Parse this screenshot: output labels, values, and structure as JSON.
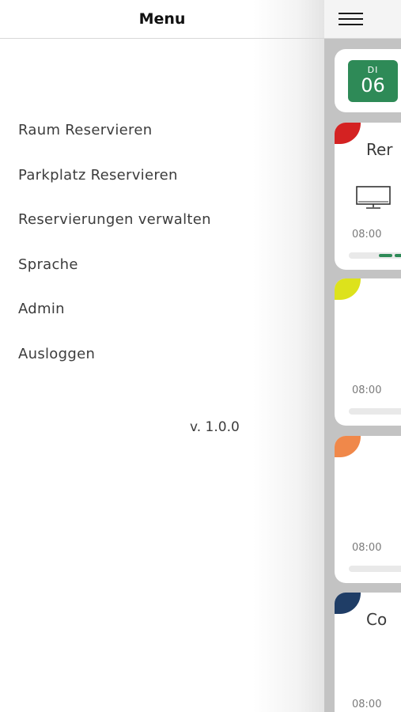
{
  "drawer": {
    "title": "Menu",
    "items": [
      {
        "label": "Raum Reservieren"
      },
      {
        "label": "Parkplatz Reservieren"
      },
      {
        "label": "Reservierungen verwalten"
      },
      {
        "label": "Sprache"
      },
      {
        "label": "Admin"
      },
      {
        "label": "Ausloggen"
      }
    ],
    "version": "v. 1.0.0"
  },
  "background": {
    "date": {
      "weekday": "DI",
      "day": "06"
    },
    "rooms": [
      {
        "name": "Rer",
        "color": "#d42222",
        "start_time": "08:00",
        "has_screen": true
      },
      {
        "name": "",
        "color": "#dde21c",
        "start_time": "08:00",
        "has_screen": false
      },
      {
        "name": "",
        "color": "#f0884a",
        "start_time": "08:00",
        "has_screen": false
      },
      {
        "name": "Co",
        "color": "#1f3d66",
        "start_time": "08:00",
        "has_screen": false
      }
    ]
  }
}
